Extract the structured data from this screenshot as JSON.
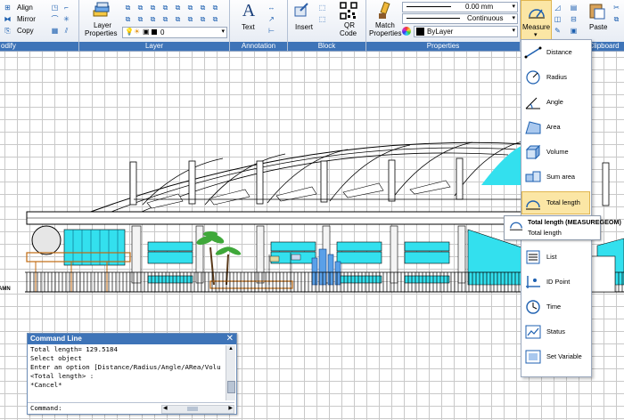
{
  "ribbon": {
    "modify": {
      "title": "odify",
      "align": "Align",
      "mirror": "Mirror",
      "copy": "Copy"
    },
    "layer": {
      "title": "Layer",
      "layer_properties_1": "Layer",
      "layer_properties_2": "Properties",
      "current_layer": "0"
    },
    "annotation": {
      "title": "Annotation",
      "text": "Text"
    },
    "block": {
      "title": "Block",
      "insert": "Insert",
      "qr_1": "QR",
      "qr_2": "Code"
    },
    "properties": {
      "title": "Properties",
      "match_1": "Match",
      "match_2": "Properties",
      "lineweight": "0.00 mm",
      "linetype": "Continuous",
      "color": "ByLayer"
    },
    "measure": {
      "label": "Measure"
    },
    "clipboard": {
      "title": "Clipboard",
      "paste": "Paste"
    }
  },
  "measure_menu": {
    "items": [
      {
        "label": "Distance",
        "icon": "distance-icon"
      },
      {
        "label": "Radius",
        "icon": "radius-icon"
      },
      {
        "label": "Angle",
        "icon": "angle-icon"
      },
      {
        "label": "Area",
        "icon": "area-icon"
      },
      {
        "label": "Volume",
        "icon": "volume-icon"
      },
      {
        "label": "Sum area",
        "icon": "sum-area-icon"
      },
      {
        "label": "Total length",
        "icon": "total-length-icon",
        "highlighted": true
      },
      {
        "label": "List",
        "icon": "list-icon"
      },
      {
        "label": "ID Point",
        "icon": "id-point-icon"
      },
      {
        "label": "Time",
        "icon": "time-icon"
      },
      {
        "label": "Status",
        "icon": "status-icon"
      },
      {
        "label": "Set Variable",
        "icon": "set-variable-icon"
      }
    ],
    "tooltip": {
      "title": "Total length (MEASUREGEOM)",
      "description": "Total length"
    }
  },
  "drawing": {
    "level_label": "AMN"
  },
  "command_line": {
    "title": "Command Line",
    "lines": [
      "Total length= 129.5184",
      "Select object",
      "Enter an option [Distance/Radius/Angle/ARea/Volu",
      "<Total length> :",
      "*Cancel*"
    ],
    "prompt": "Command:"
  },
  "colors": {
    "ribbon_panel_title": "#3e74b8",
    "highlight": "#fbe6a5",
    "cyan_glass": "#33e0ee"
  }
}
